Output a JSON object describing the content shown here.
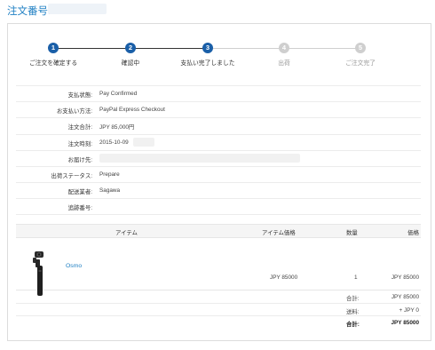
{
  "header": {
    "title": "注文番号:"
  },
  "steps": [
    {
      "number": "1",
      "label": "ご注文を確定する",
      "active": true
    },
    {
      "number": "2",
      "label": "確認中",
      "active": true
    },
    {
      "number": "3",
      "label": "支払い完了しました",
      "active": true
    },
    {
      "number": "4",
      "label": "出荷",
      "active": false
    },
    {
      "number": "5",
      "label": "ご注文完了",
      "active": false
    }
  ],
  "order_info": {
    "payment_status": {
      "label": "支払状態:",
      "value": "Pay Confirmed"
    },
    "payment_method": {
      "label": "お支払い方法:",
      "value": "PayPal Express Checkout"
    },
    "order_total": {
      "label": "注文合計:",
      "value": "JPY 85,000円"
    },
    "order_date": {
      "label": "注文時刻:",
      "value": "2015-10-09"
    },
    "shipping_address": {
      "label": "お届け先:",
      "value": ""
    },
    "shipping_status": {
      "label": "出荷ステータス:",
      "value": "Prepare"
    },
    "carrier": {
      "label": "配送業者:",
      "value": "Sagawa"
    },
    "tracking": {
      "label": "追跡番号:",
      "value": ""
    }
  },
  "items_table": {
    "headers": {
      "item": "アイテム",
      "price": "アイテム価格",
      "qty": "数量",
      "amount": "価格"
    },
    "rows": [
      {
        "name": "Osmo",
        "price": "JPY 85000",
        "qty": "1",
        "amount": "JPY 85000"
      }
    ],
    "summary": {
      "subtotal": {
        "label": "合計:",
        "value": "JPY 85000"
      },
      "shipping": {
        "label": "送料:",
        "value": "+ JPY 0"
      },
      "total": {
        "label": "合計:",
        "value": "JPY 85000"
      }
    }
  },
  "colors": {
    "accent": "#1e7fc3",
    "step_active": "#1a5fa8",
    "step_inactive": "#cfcfcf"
  }
}
